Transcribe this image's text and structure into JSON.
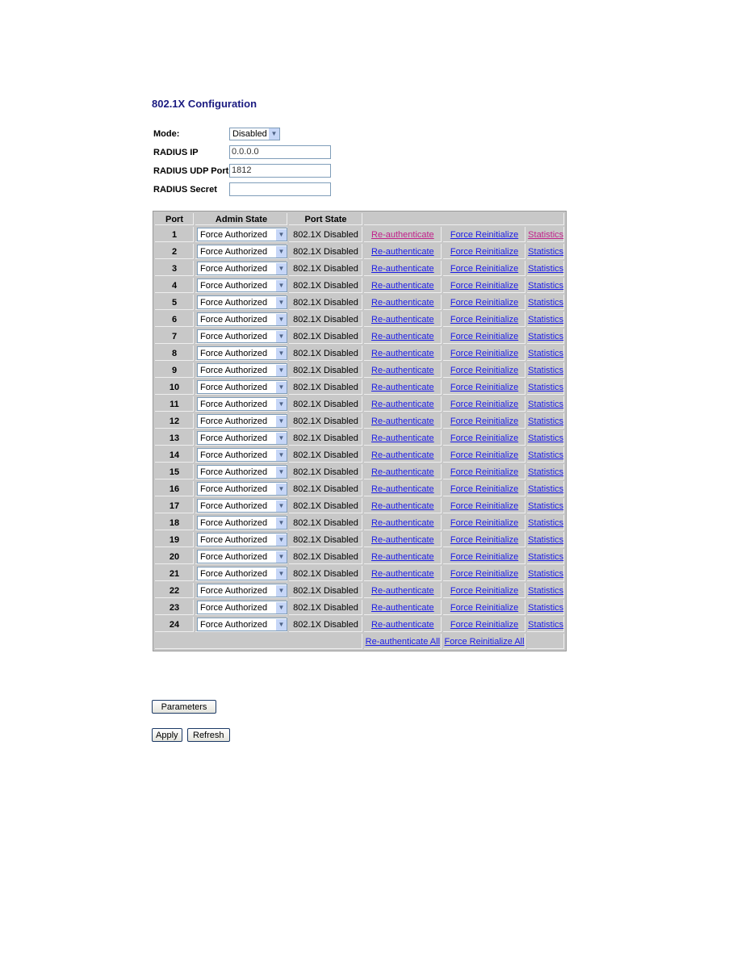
{
  "title": "802.1X Configuration",
  "form": {
    "mode_label": "Mode:",
    "mode_value": "Disabled",
    "radius_ip_label": "RADIUS IP",
    "radius_ip_value": "0.0.0.0",
    "radius_port_label": "RADIUS UDP Port",
    "radius_port_value": "1812",
    "radius_secret_label": "RADIUS Secret",
    "radius_secret_value": ""
  },
  "table": {
    "headers": [
      "Port",
      "Admin State",
      "Port State",
      ""
    ],
    "rows": [
      {
        "port": "1",
        "admin": "Force Authorized",
        "state": "802.1X Disabled",
        "visited": true
      },
      {
        "port": "2",
        "admin": "Force Authorized",
        "state": "802.1X Disabled"
      },
      {
        "port": "3",
        "admin": "Force Authorized",
        "state": "802.1X Disabled"
      },
      {
        "port": "4",
        "admin": "Force Authorized",
        "state": "802.1X Disabled"
      },
      {
        "port": "5",
        "admin": "Force Authorized",
        "state": "802.1X Disabled"
      },
      {
        "port": "6",
        "admin": "Force Authorized",
        "state": "802.1X Disabled"
      },
      {
        "port": "7",
        "admin": "Force Authorized",
        "state": "802.1X Disabled"
      },
      {
        "port": "8",
        "admin": "Force Authorized",
        "state": "802.1X Disabled"
      },
      {
        "port": "9",
        "admin": "Force Authorized",
        "state": "802.1X Disabled"
      },
      {
        "port": "10",
        "admin": "Force Authorized",
        "state": "802.1X Disabled"
      },
      {
        "port": "11",
        "admin": "Force Authorized",
        "state": "802.1X Disabled"
      },
      {
        "port": "12",
        "admin": "Force Authorized",
        "state": "802.1X Disabled"
      },
      {
        "port": "13",
        "admin": "Force Authorized",
        "state": "802.1X Disabled"
      },
      {
        "port": "14",
        "admin": "Force Authorized",
        "state": "802.1X Disabled"
      },
      {
        "port": "15",
        "admin": "Force Authorized",
        "state": "802.1X Disabled"
      },
      {
        "port": "16",
        "admin": "Force Authorized",
        "state": "802.1X Disabled"
      },
      {
        "port": "17",
        "admin": "Force Authorized",
        "state": "802.1X Disabled"
      },
      {
        "port": "18",
        "admin": "Force Authorized",
        "state": "802.1X Disabled"
      },
      {
        "port": "19",
        "admin": "Force Authorized",
        "state": "802.1X Disabled"
      },
      {
        "port": "20",
        "admin": "Force Authorized",
        "state": "802.1X Disabled"
      },
      {
        "port": "21",
        "admin": "Force Authorized",
        "state": "802.1X Disabled"
      },
      {
        "port": "22",
        "admin": "Force Authorized",
        "state": "802.1X Disabled"
      },
      {
        "port": "23",
        "admin": "Force Authorized",
        "state": "802.1X Disabled"
      },
      {
        "port": "24",
        "admin": "Force Authorized",
        "state": "802.1X Disabled"
      }
    ],
    "link_reauth": "Re-authenticate",
    "link_reinit": "Force Reinitialize",
    "link_stats": "Statistics",
    "link_reauth_all": "Re-authenticate All",
    "link_reinit_all": "Force Reinitialize All"
  },
  "buttons": {
    "parameters": "Parameters",
    "apply": "Apply",
    "refresh": "Refresh"
  },
  "colors": {
    "link": "#1a1ae6",
    "visited_link": "#c0208a",
    "title": "#1a1a80",
    "table_bg": "#c8c8c8"
  }
}
